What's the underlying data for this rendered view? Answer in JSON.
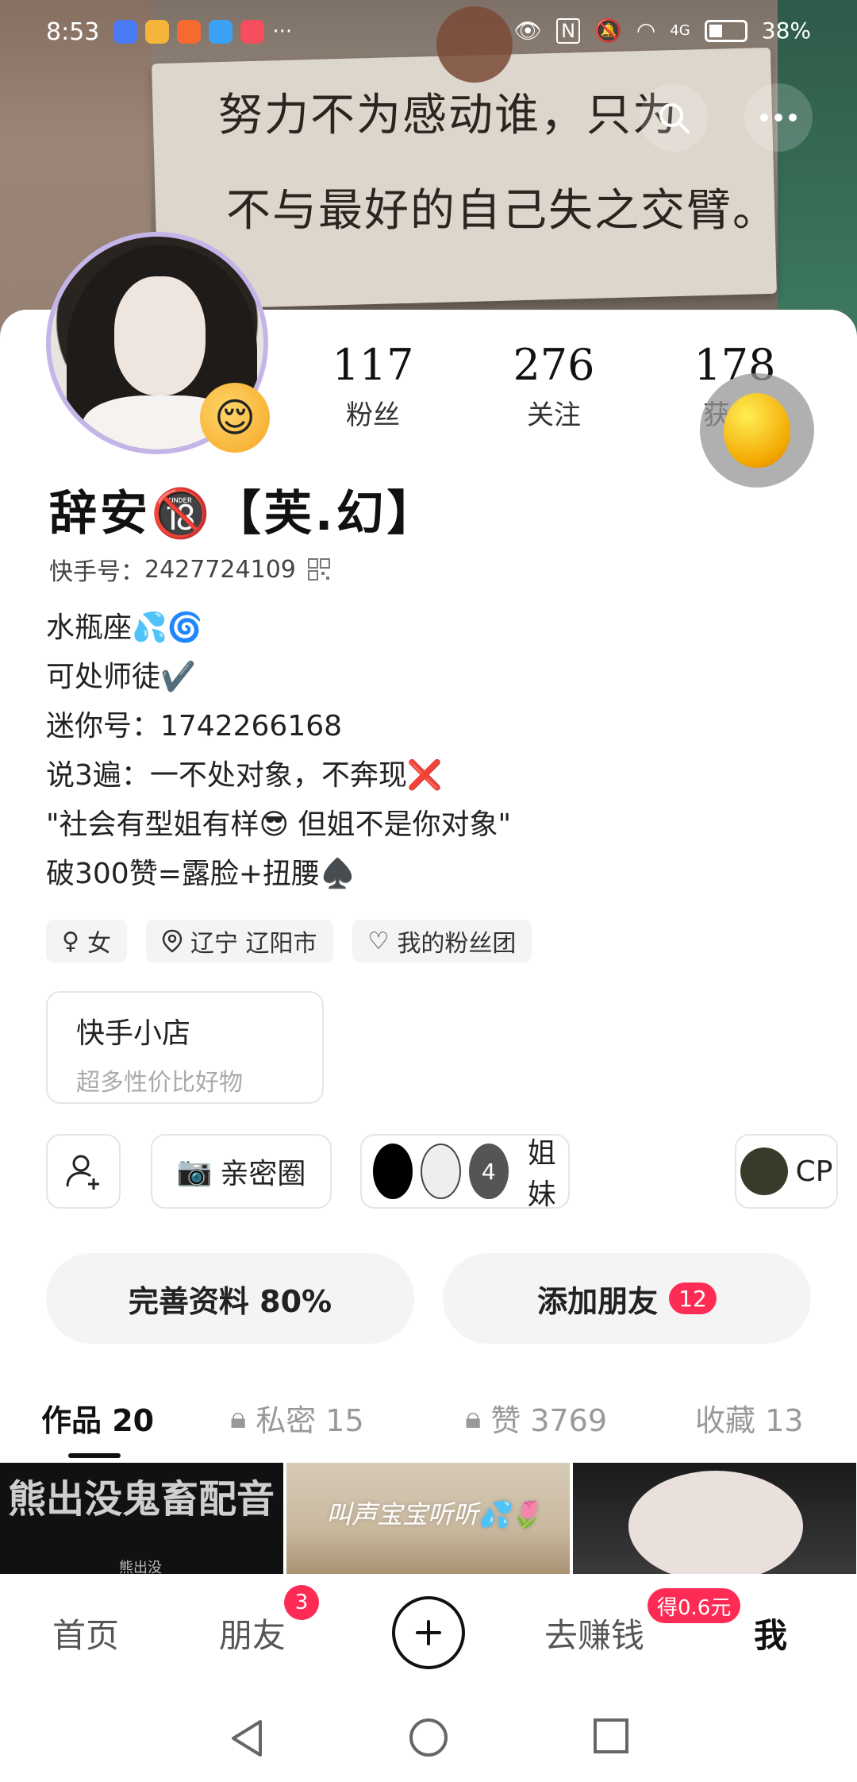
{
  "status_bar": {
    "time": "8:53",
    "battery": "38%",
    "network": "4G"
  },
  "banner": {
    "line1": "努力不为感动谁，只为",
    "line2": "不与最好的自己失之交臂。"
  },
  "profile": {
    "name": "辞安🔞【芙.幻】",
    "kuaishou_id_label": "快手号：",
    "kuaishou_id": "2427724109",
    "stats": [
      {
        "num": "117",
        "label": "粉丝"
      },
      {
        "num": "276",
        "label": "关注"
      },
      {
        "num": "178",
        "label": "获"
      }
    ],
    "bio": [
      "水瓶座💦🌀",
      "可处师徒✔️",
      "迷你号：1742266168",
      "说3遍：一不处对象，不奔现❌",
      "\"社会有型姐有样😎 但姐不是你对象\"",
      "破300赞=露脸+扭腰♠️"
    ],
    "tags": [
      {
        "icon": "female-icon",
        "text": "女"
      },
      {
        "icon": "location-icon",
        "text": "辽宁 辽阳市"
      },
      {
        "icon": "heart-icon",
        "text": "我的粉丝团"
      }
    ]
  },
  "shop": {
    "title": "快手小店",
    "subtitle": "超多性价比好物"
  },
  "circles": {
    "intimate": "亲密圈",
    "sisters": "姐妹",
    "sisters_count": "4",
    "cp": "CP"
  },
  "actions": {
    "complete": "完善资料 80%",
    "add_friend": "添加朋友",
    "add_friend_count": "12"
  },
  "tabs": [
    {
      "label": "作品 20",
      "locked": false,
      "active": true
    },
    {
      "label": "私密 15",
      "locked": true,
      "active": false
    },
    {
      "label": "赞 3769",
      "locked": true,
      "active": false
    },
    {
      "label": "收藏 13",
      "locked": false,
      "active": false
    }
  ],
  "thumbs": {
    "t1_big": "熊出没鬼畜配音",
    "t1_small": "熊出没",
    "t2_text": "叫声宝宝听听💦🌷"
  },
  "bottom_nav": {
    "home": "首页",
    "friends": "朋友",
    "friends_badge": "3",
    "earn": "去赚钱",
    "earn_badge": "得0.6元",
    "me": "我"
  }
}
